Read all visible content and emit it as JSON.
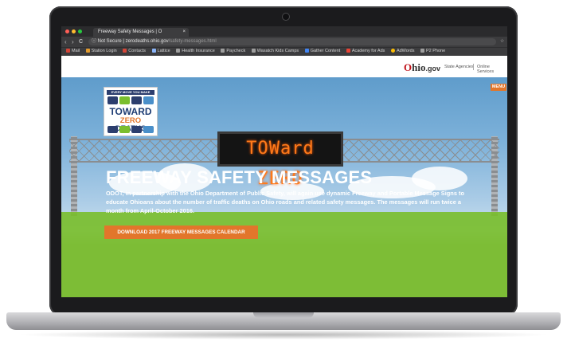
{
  "browser": {
    "tab_title": "Freeway Safety Messages | O",
    "tab_close": "×",
    "nav_back": "‹",
    "nav_forward": "›",
    "nav_reload": "C",
    "security_label": "ⓘ Not Secure |",
    "url_host": "zerodeaths.ohio.gov",
    "url_path": "/safety-messages.html",
    "star_icon": "☆",
    "bookmarks": [
      {
        "label": "Mail",
        "color": "#d44638"
      },
      {
        "label": "Station Login",
        "color": "#e39b2d"
      },
      {
        "label": "Contacts",
        "color": "#d44638"
      },
      {
        "label": "Lattice",
        "color": "#8ab4f8"
      },
      {
        "label": "Health Insurance",
        "color": "#9e9e9e"
      },
      {
        "label": "Paycheck",
        "color": "#9e9e9e"
      },
      {
        "label": "Wasatch Kids Camps",
        "color": "#9e9e9e"
      },
      {
        "label": "Gather Content",
        "color": "#4285f4"
      },
      {
        "label": "Academy for Ads",
        "color": "#ea4335"
      },
      {
        "label": "AdWords",
        "color": "#fbbc05"
      },
      {
        "label": "P2 Phone",
        "color": "#9e9e9e"
      }
    ]
  },
  "header": {
    "brand_o": "O",
    "brand_hio": "hio",
    "brand_gov": ".gov",
    "links": [
      "State Agencies",
      "Online Services"
    ]
  },
  "hero": {
    "menu_label": "MENU",
    "logo_top": "EVERY MOVE YOU MAKE",
    "logo_line1": "TOWARD",
    "logo_zero": "ZERO",
    "logo_deaths": "DEATHS",
    "sign_text": "TOWard ZERO",
    "title": "FREEWAY SAFETY MESSAGES",
    "description": "ODOT, in partnership with the Ohio Department of Public Safety, will again use dynamic Freeway and Portable Message Signs to educate Ohioans about the number of traffic deaths on Ohio roads and related safety messages. The messages will run twice a month from April-October 2016.",
    "cta_label": "DOWNLOAD 2017 FREEWAY MESSAGES CALENDAR"
  },
  "colors": {
    "accent_orange": "#e2762b",
    "hero_green": "#7abe2e",
    "ohio_red": "#c0141c",
    "logo_navy": "#1d3c73"
  }
}
